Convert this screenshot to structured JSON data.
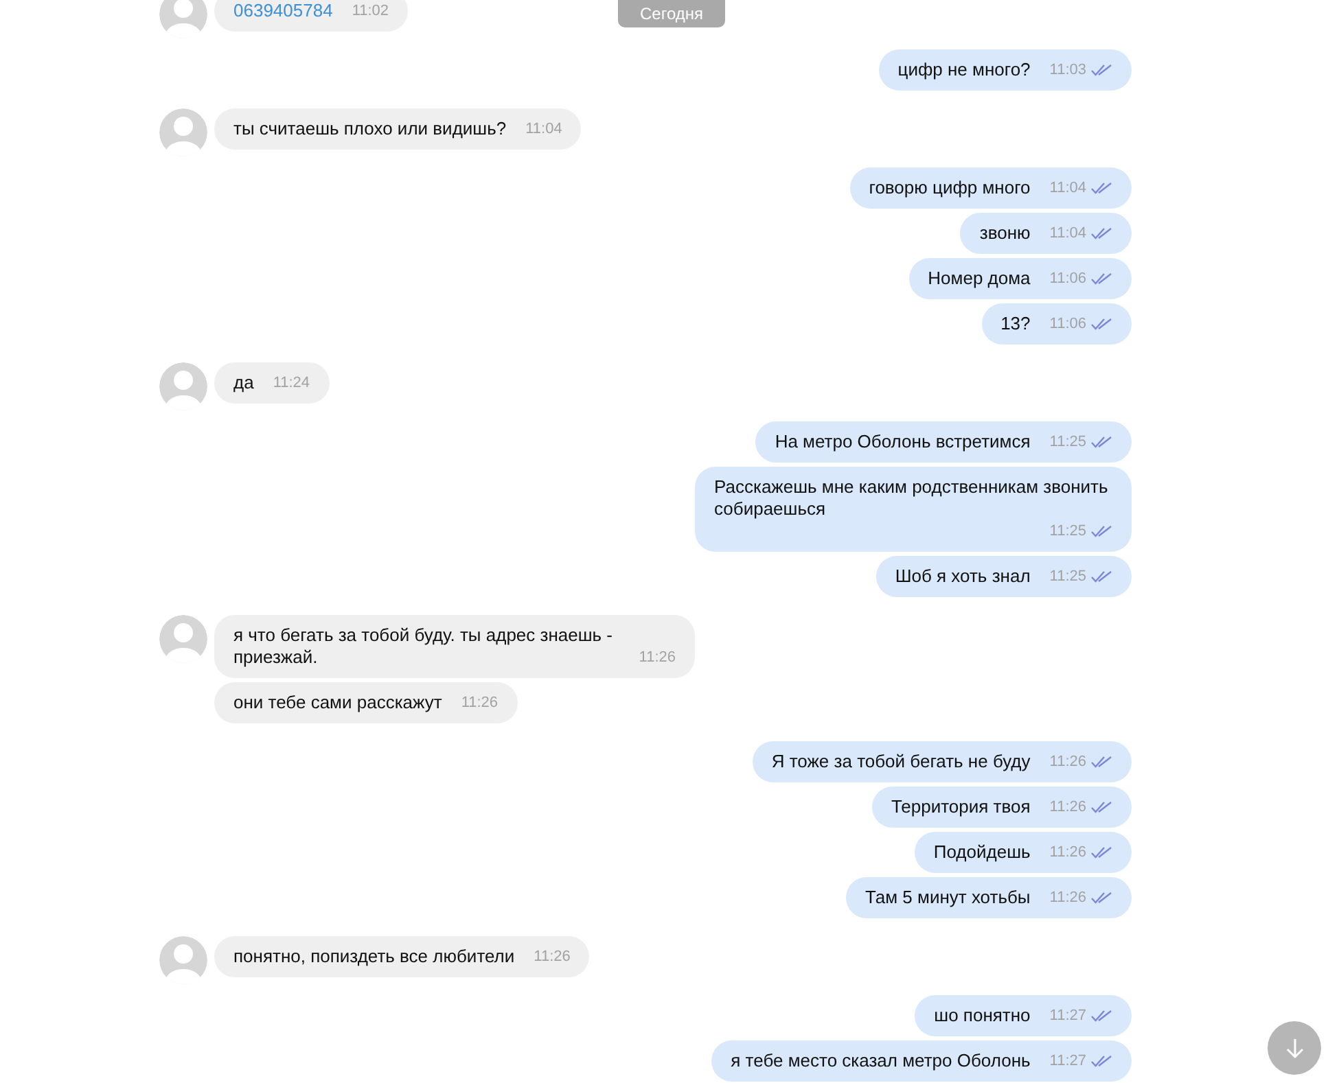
{
  "date_badge": "Сегодня",
  "groups": [
    {
      "kind": "incoming",
      "messages": [
        {
          "kind": "phone",
          "text": "0639405784",
          "time": "11:02"
        }
      ]
    },
    {
      "kind": "outgoing",
      "messages": [
        {
          "kind": "text",
          "text": "цифр не много?",
          "time": "11:03",
          "read": true
        }
      ]
    },
    {
      "kind": "incoming",
      "messages": [
        {
          "kind": "text",
          "text": "ты считаешь плохо или видишь?",
          "time": "11:04"
        }
      ]
    },
    {
      "kind": "outgoing",
      "messages": [
        {
          "kind": "text",
          "text": "говорю цифр много",
          "time": "11:04",
          "read": true
        },
        {
          "kind": "text",
          "text": "звоню",
          "time": "11:04",
          "read": true
        },
        {
          "kind": "text",
          "text": "Номер дома",
          "time": "11:06",
          "read": true
        },
        {
          "kind": "text",
          "text": "13?",
          "time": "11:06",
          "read": true
        }
      ]
    },
    {
      "kind": "incoming",
      "messages": [
        {
          "kind": "text",
          "text": "да",
          "time": "11:24"
        }
      ]
    },
    {
      "kind": "outgoing",
      "messages": [
        {
          "kind": "text",
          "text": "На метро Оболонь встретимся",
          "time": "11:25",
          "read": true
        },
        {
          "kind": "text",
          "text": "Расскажешь мне каким родственникам звонить собираешься",
          "time": "11:25",
          "read": true
        },
        {
          "kind": "text",
          "text": "Шоб я хоть знал",
          "time": "11:25",
          "read": true
        }
      ]
    },
    {
      "kind": "incoming",
      "messages": [
        {
          "kind": "text",
          "text": "я что бегать за тобой буду. ты адрес знаешь - приезжай.",
          "time": "11:26"
        },
        {
          "kind": "text",
          "text": "они тебе сами расскажут",
          "time": "11:26"
        }
      ]
    },
    {
      "kind": "outgoing",
      "messages": [
        {
          "kind": "text",
          "text": "Я тоже за тобой бегать не буду",
          "time": "11:26",
          "read": true
        },
        {
          "kind": "text",
          "text": "Территория твоя",
          "time": "11:26",
          "read": true
        },
        {
          "kind": "text",
          "text": "Подойдешь",
          "time": "11:26",
          "read": true
        },
        {
          "kind": "text",
          "text": "Там 5 минут хотьбы",
          "time": "11:26",
          "read": true
        }
      ]
    },
    {
      "kind": "incoming",
      "messages": [
        {
          "kind": "text",
          "text": "понятно,  попиздеть все любители",
          "time": "11:26"
        }
      ]
    },
    {
      "kind": "outgoing",
      "messages": [
        {
          "kind": "text",
          "text": "шо понятно",
          "time": "11:27",
          "read": true
        },
        {
          "kind": "text",
          "text": "я тебе место сказал метро Оболонь",
          "time": "11:27",
          "read": true
        }
      ]
    }
  ]
}
